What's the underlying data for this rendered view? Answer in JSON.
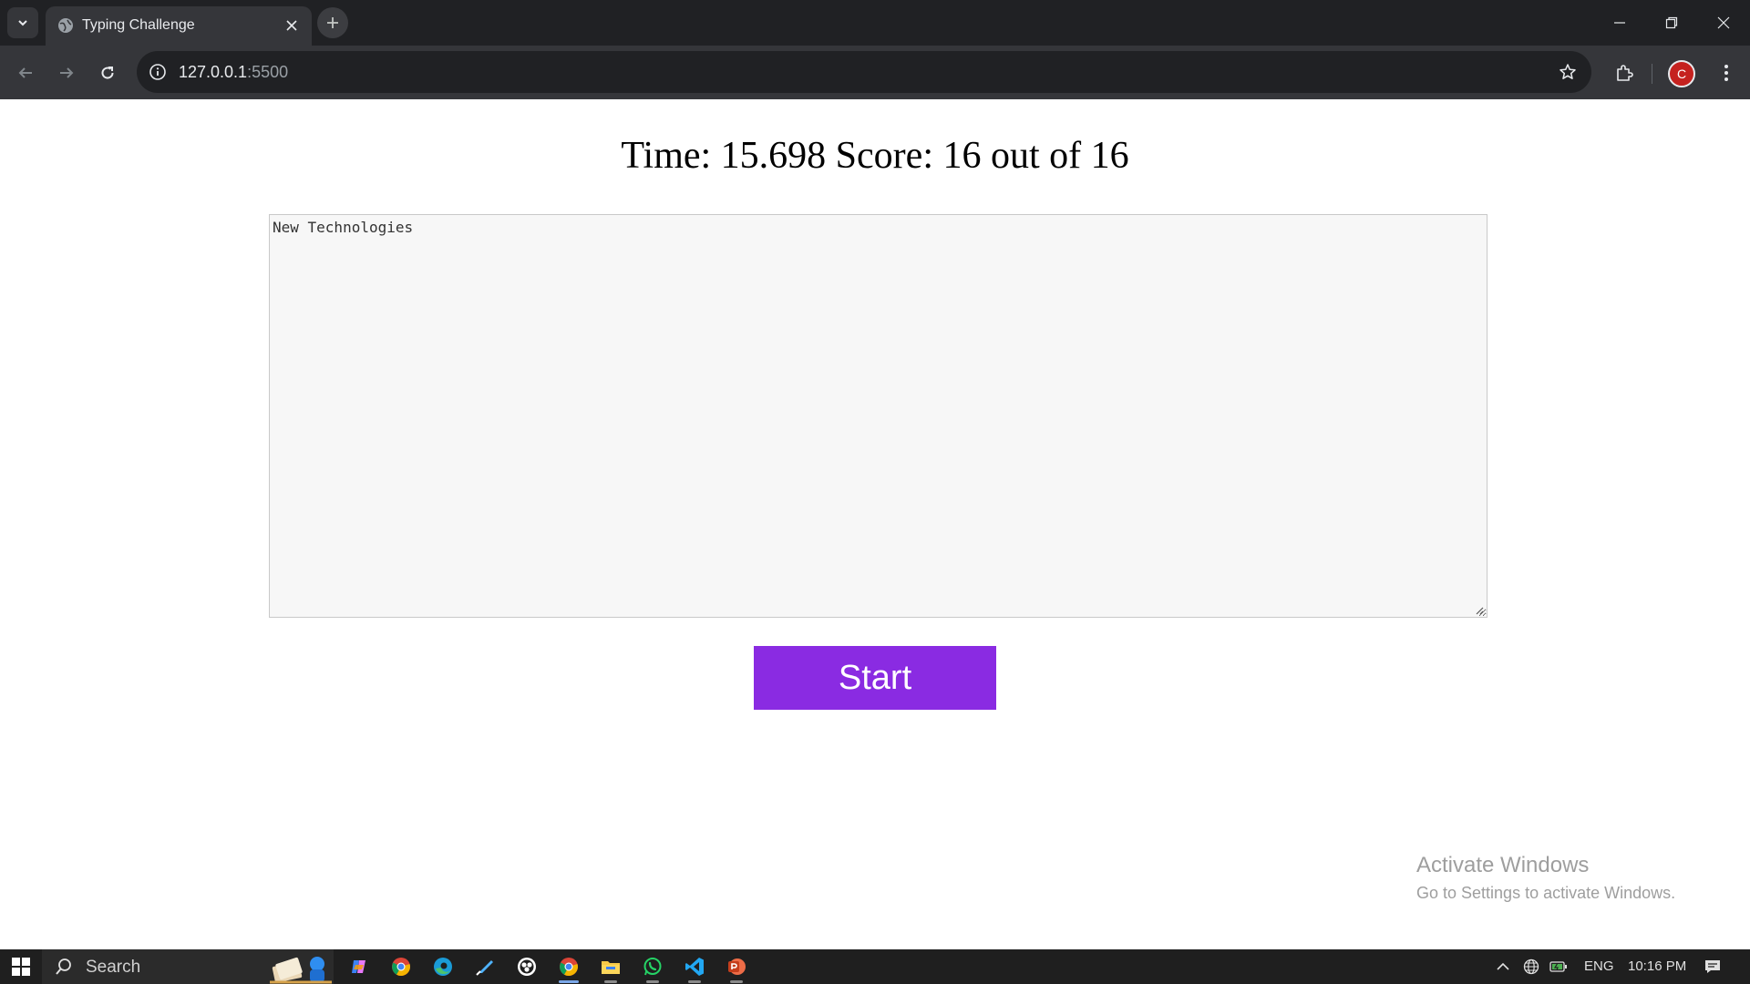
{
  "browser": {
    "tab_title": "Typing Challenge",
    "url_host": "127.0.0.1",
    "url_port": ":5500",
    "profile_initial": "C"
  },
  "page": {
    "status_text": "Time: 15.698 Score: 16 out of 16",
    "textarea_value": "New Technologies",
    "start_label": "Start"
  },
  "watermark": {
    "title": "Activate Windows",
    "subtitle": "Go to Settings to activate Windows."
  },
  "taskbar": {
    "search_label": "Search",
    "language": "ENG",
    "time": "10:16 PM",
    "apps": [
      "copilot",
      "chrome",
      "edge",
      "terminal",
      "obs",
      "chrome-active",
      "file-explorer",
      "whatsapp",
      "vscode",
      "powerpoint"
    ]
  },
  "colors": {
    "accent_button": "#8a2be2",
    "chrome_dark": "#202124",
    "chrome_toolbar": "#35363a"
  }
}
